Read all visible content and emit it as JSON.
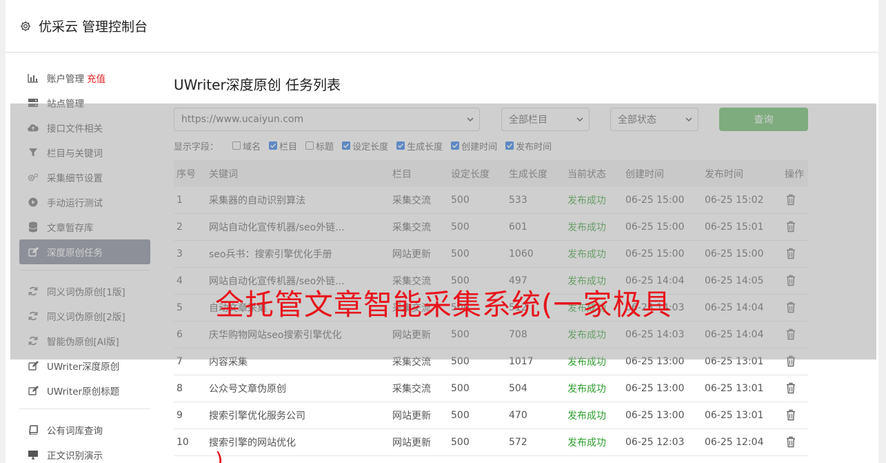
{
  "header": {
    "title": "优采云 管理控制台"
  },
  "sidebar": {
    "items": [
      {
        "label": "账户管理",
        "tag": "充值",
        "icon": "bar-chart-icon"
      },
      {
        "label": "站点管理",
        "icon": "server-icon"
      },
      {
        "label": "接口文件相关",
        "icon": "cloud-upload-icon"
      },
      {
        "label": "栏目与关键词",
        "icon": "filter-icon"
      },
      {
        "label": "采集细节设置",
        "icon": "gears-icon"
      },
      {
        "label": "手动运行测试",
        "icon": "play-icon"
      },
      {
        "label": "文章暂存库",
        "icon": "database-icon"
      },
      {
        "label": "深度原创任务",
        "icon": "edit-icon",
        "active": true
      }
    ],
    "items2": [
      {
        "label": "同义词伪原创[1版]",
        "icon": "refresh-icon"
      },
      {
        "label": "同义词伪原创[2版]",
        "icon": "refresh-icon"
      },
      {
        "label": "智能伪原创[AI版]",
        "icon": "refresh-icon"
      },
      {
        "label": "UWriter深度原创",
        "icon": "edit-icon"
      },
      {
        "label": "UWriter原创标题",
        "icon": "edit-icon"
      }
    ],
    "items3": [
      {
        "label": "公有词库查询",
        "icon": "book-icon"
      },
      {
        "label": "正文识别演示",
        "icon": "monitor-icon"
      }
    ]
  },
  "page": {
    "title": "UWriter深度原创 任务列表",
    "site_select": "https://www.ucaiyun.com",
    "column_select": "全部栏目",
    "status_select": "全部状态",
    "query_label": "查询",
    "fields_label": "显示字段：",
    "fields": [
      {
        "label": "域名",
        "checked": false
      },
      {
        "label": "栏目",
        "checked": true
      },
      {
        "label": "标题",
        "checked": false
      },
      {
        "label": "设定长度",
        "checked": true
      },
      {
        "label": "生成长度",
        "checked": true
      },
      {
        "label": "创建时间",
        "checked": true
      },
      {
        "label": "发布时间",
        "checked": true
      }
    ]
  },
  "table": {
    "headers": [
      "序号",
      "关键词",
      "栏目",
      "设定长度",
      "生成长度",
      "当前状态",
      "创建时间",
      "发布时间",
      "操作"
    ],
    "rows": [
      [
        "1",
        "采集器的自动识别算法",
        "采集交流",
        "500",
        "533",
        "发布成功",
        "06-25 15:00",
        "06-25 15:02"
      ],
      [
        "2",
        "网站自动化宣传机器/seo外链...",
        "采集交流",
        "500",
        "601",
        "发布成功",
        "06-25 15:00",
        "06-25 15:01"
      ],
      [
        "3",
        "seo兵书：搜索引擎优化手册",
        "网站更新",
        "500",
        "1060",
        "发布成功",
        "06-25 15:00",
        "06-25 15:00"
      ],
      [
        "4",
        "网站自动化宣传机器/seo外链...",
        "采集交流",
        "500",
        "497",
        "发布成功",
        "06-25 14:04",
        "06-25 14:05"
      ],
      [
        "5",
        "自动文章采集",
        "采集交流",
        "500",
        "512",
        "发布成功",
        "06-25 14:03",
        "06-25 14:04"
      ],
      [
        "6",
        "庆华购物网站seo搜索引擎优化",
        "网站更新",
        "500",
        "708",
        "发布成功",
        "06-25 14:03",
        "06-25 14:04"
      ],
      [
        "7",
        "内容采集",
        "采集交流",
        "500",
        "1017",
        "发布成功",
        "06-25 13:00",
        "06-25 13:01"
      ],
      [
        "8",
        "公众号文章伪原创",
        "采集交流",
        "500",
        "504",
        "发布成功",
        "06-25 13:00",
        "06-25 13:01"
      ],
      [
        "9",
        "搜索引擎优化服务公司",
        "网站更新",
        "500",
        "470",
        "发布成功",
        "06-25 13:00",
        "06-25 13:01"
      ],
      [
        "10",
        "搜索引擎的网站优化",
        "网站更新",
        "500",
        "572",
        "发布成功",
        "06-25 12:03",
        "06-25 12:04"
      ]
    ]
  },
  "overlay": {
    "banner_line1": "全托管文章智能采集系统(一家极具",
    "banner_line2": ")"
  },
  "colors": {
    "active_bg": "#7a8190",
    "query_bg": "#5cb85c",
    "success": "#2e9e2e",
    "banner": "#e8141c"
  }
}
